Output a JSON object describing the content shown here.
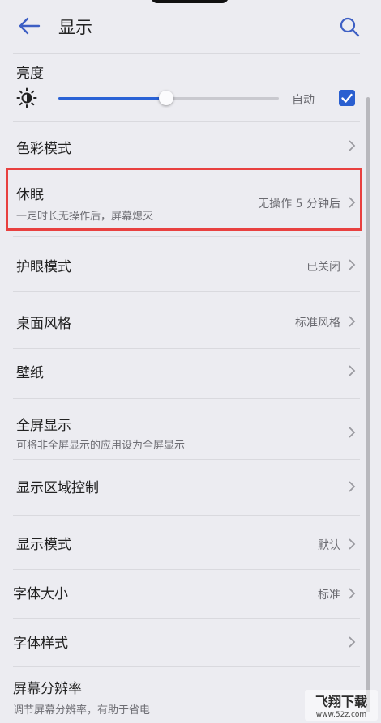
{
  "header": {
    "title": "显示"
  },
  "brightness": {
    "label": "亮度",
    "auto_label": "自动",
    "level": 0.49,
    "auto_checked": true
  },
  "items": [
    {
      "label": "色彩模式",
      "sub": "",
      "value": ""
    },
    {
      "label": "休眠",
      "sub": "一定时长无操作后，屏幕熄灭",
      "value": "无操作 5 分钟后"
    },
    {
      "label": "护眼模式",
      "sub": "",
      "value": "已关闭"
    },
    {
      "label": "桌面风格",
      "sub": "",
      "value": "标准风格"
    },
    {
      "label": "壁纸",
      "sub": "",
      "value": ""
    },
    {
      "label": "全屏显示",
      "sub": "可将非全屏显示的应用设为全屏显示",
      "value": ""
    },
    {
      "label": "显示区域控制",
      "sub": "",
      "value": ""
    },
    {
      "label": "显示模式",
      "sub": "",
      "value": "默认"
    },
    {
      "label": "字体大小",
      "sub": "",
      "value": "标准"
    },
    {
      "label": "字体样式",
      "sub": "",
      "value": ""
    },
    {
      "label": "屏幕分辨率",
      "sub": "调节屏幕分辨率，有助于省电",
      "value": ""
    }
  ],
  "watermark": {
    "text": "飞翔下载",
    "site": "www.52z.com"
  },
  "colors": {
    "accent": "#2a62d6",
    "highlight": "#e8403f"
  }
}
